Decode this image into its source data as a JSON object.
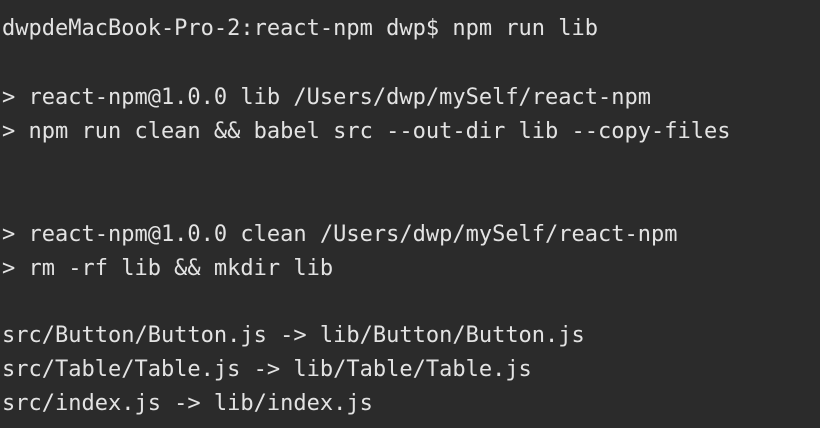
{
  "terminal": {
    "lines": [
      "dwpdeMacBook-Pro-2:react-npm dwp$ npm run lib",
      "> react-npm@1.0.0 lib /Users/dwp/mySelf/react-npm",
      "> npm run clean && babel src --out-dir lib --copy-files",
      "> react-npm@1.0.0 clean /Users/dwp/mySelf/react-npm",
      "> rm -rf lib && mkdir lib",
      "src/Button/Button.js -> lib/Button/Button.js",
      "src/Table/Table.js -> lib/Table/Table.js",
      "src/index.js -> lib/index.js"
    ]
  }
}
